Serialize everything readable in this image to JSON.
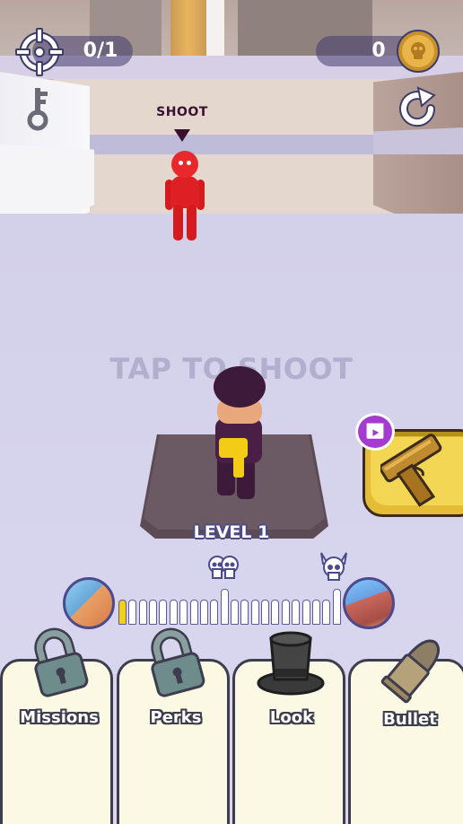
{
  "hud": {
    "targets": "0/1",
    "coins": "0",
    "target_icon": "crosshair-icon",
    "coin_icon": "coin-icon",
    "key_icon": "key-icon",
    "restart_icon": "restart-icon"
  },
  "scene": {
    "enemy_label": "SHOOT",
    "hint": "TAP TO SHOOT"
  },
  "weapon": {
    "icon": "pistol-icon",
    "badge_icon": "video-ad-icon",
    "color": "#f3d653"
  },
  "level": {
    "label": "LEVEL 1",
    "progress": {
      "completed": 1,
      "total": 22
    },
    "milestones": [
      "skulls-icon",
      "boss-skull-icon"
    ]
  },
  "tabs": [
    {
      "label": "Missions",
      "icon": "padlock-icon",
      "locked": true
    },
    {
      "label": "Perks",
      "icon": "padlock-icon",
      "locked": true
    },
    {
      "label": "Look",
      "icon": "top-hat-icon",
      "locked": false
    },
    {
      "label": "Bullet",
      "icon": "bullet-icon",
      "locked": false
    }
  ],
  "colors": {
    "outline": "#4b4a8c",
    "gold": "#f3d653",
    "enemy": "#e8282a",
    "tab_bg": "#fbf9e4"
  }
}
